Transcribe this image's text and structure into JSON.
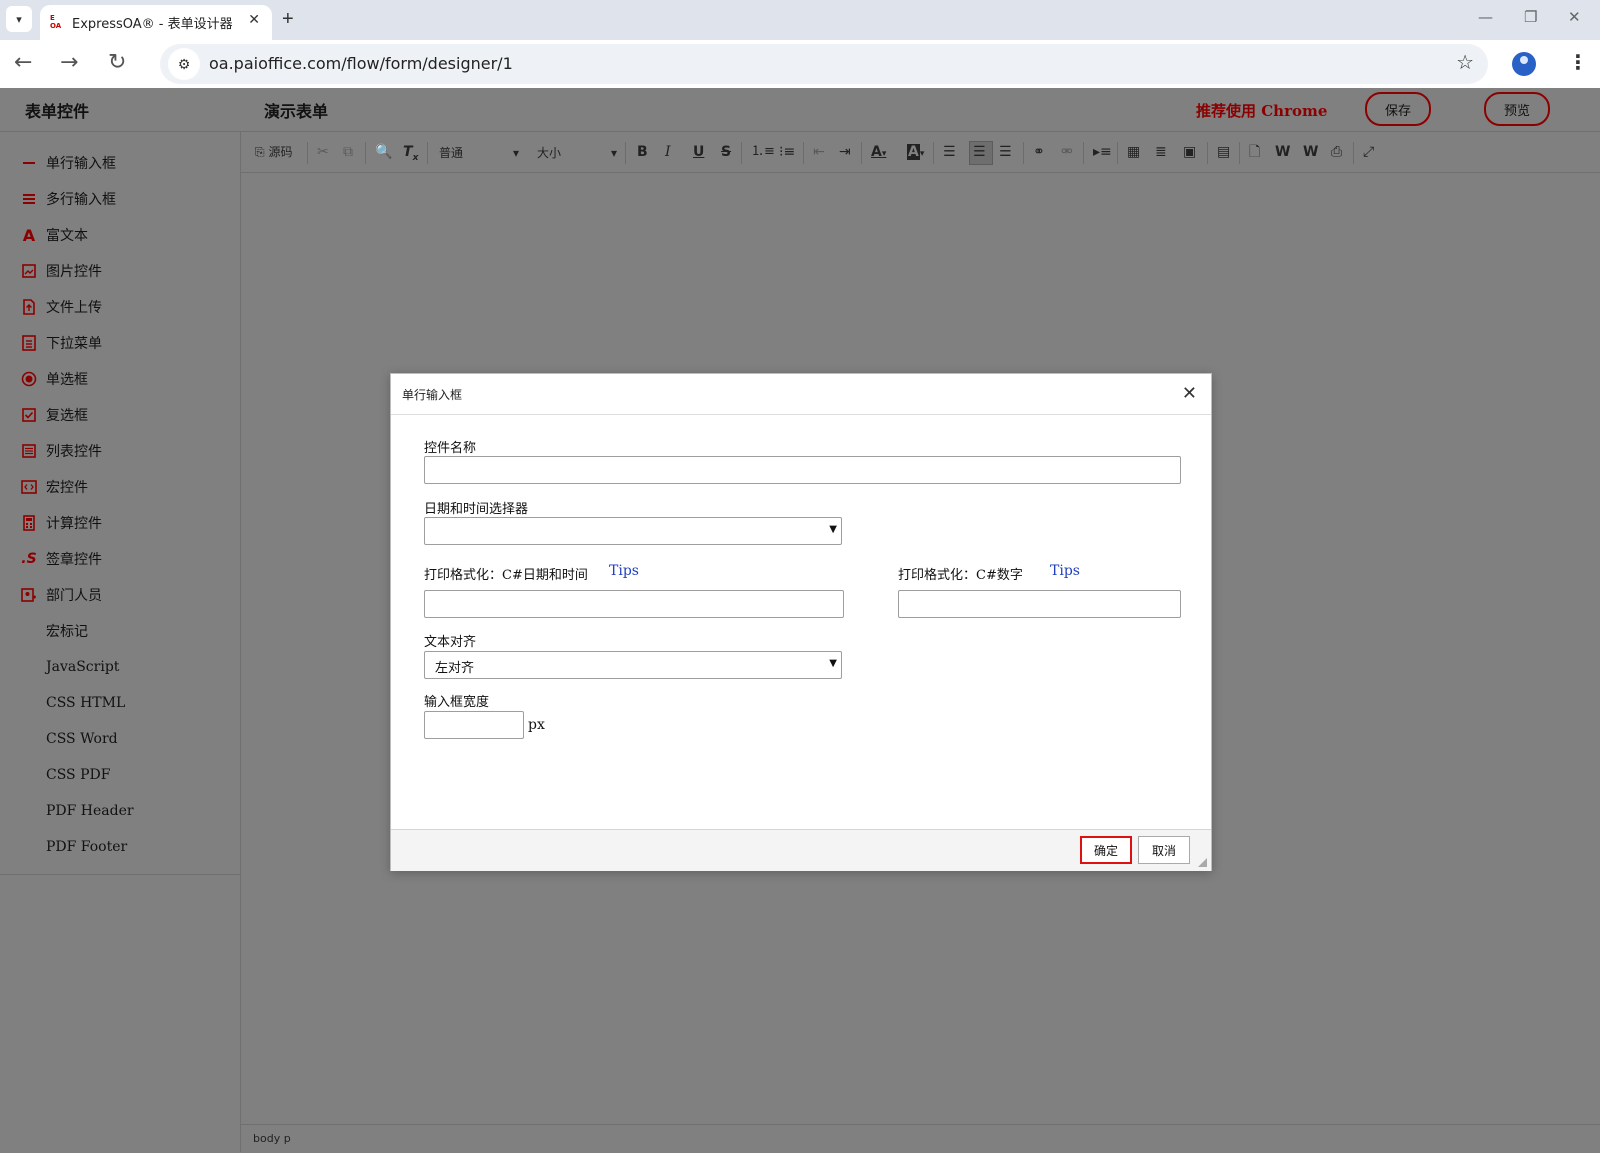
{
  "browser": {
    "tab_title": "ExpressOA® - 表单设计器",
    "favicon_text": "E OA",
    "url": "oa.paioffice.com/flow/form/designer/1"
  },
  "header": {
    "left_title": "表单控件",
    "form_title": "演示表单",
    "recommend": "推荐使用 Chrome",
    "save_label": "保存",
    "preview_label": "预览",
    "accent_color": "#8b0000"
  },
  "sidebar": {
    "items": [
      {
        "label": "单行输入框",
        "icon": "single-line-icon"
      },
      {
        "label": "多行输入框",
        "icon": "multi-line-icon"
      },
      {
        "label": "富文本",
        "icon": "rich-text-icon"
      },
      {
        "label": "图片控件",
        "icon": "image-icon"
      },
      {
        "label": "文件上传",
        "icon": "file-upload-icon"
      },
      {
        "label": "下拉菜单",
        "icon": "dropdown-icon"
      },
      {
        "label": "单选框",
        "icon": "radio-icon"
      },
      {
        "label": "复选框",
        "icon": "checkbox-icon"
      },
      {
        "label": "列表控件",
        "icon": "list-icon"
      },
      {
        "label": "宏控件",
        "icon": "macro-icon"
      },
      {
        "label": "计算控件",
        "icon": "calculator-icon"
      },
      {
        "label": "签章控件",
        "icon": "signature-icon"
      },
      {
        "label": "部门人员",
        "icon": "department-icon"
      },
      {
        "label": "宏标记",
        "icon": ""
      },
      {
        "label": "JavaScript",
        "icon": ""
      },
      {
        "label": "CSS HTML",
        "icon": ""
      },
      {
        "label": "CSS Word",
        "icon": ""
      },
      {
        "label": "CSS PDF",
        "icon": ""
      },
      {
        "label": "PDF Header",
        "icon": ""
      },
      {
        "label": "PDF Footer",
        "icon": ""
      }
    ]
  },
  "toolbar": {
    "source_label": "源码",
    "format_value": "普通",
    "size_value": "大小"
  },
  "statusbar": {
    "path": "body  p"
  },
  "dialog": {
    "title": "单行输入框",
    "control_name_label": "控件名称",
    "control_name_value": "",
    "datetime_label": "日期和时间选择器",
    "datetime_value": "",
    "print_date_label": "打印格式化：C#日期和时间",
    "print_date_tips": "Tips",
    "print_date_value": "",
    "print_number_label": "打印格式化：C#数字",
    "print_number_tips": "Tips",
    "print_number_value": "",
    "align_label": "文本对齐",
    "align_value": "左对齐",
    "width_label": "输入框宽度",
    "width_value": "",
    "width_unit": "px",
    "ok_label": "确定",
    "cancel_label": "取消"
  }
}
